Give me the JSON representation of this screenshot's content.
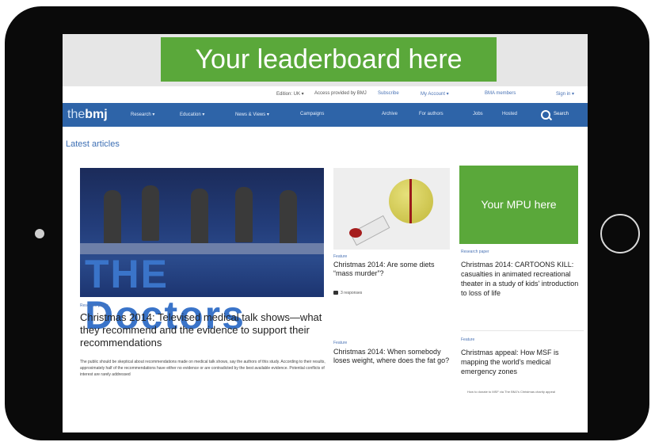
{
  "ads": {
    "leaderboard": "Your leaderboard here",
    "mpu": "Your MPU here"
  },
  "utility": {
    "edition": "Edition: UK ▾",
    "access": "Access provided by BMJ",
    "subscribe": "Subscribe",
    "account": "My Account ▾",
    "members": "BMA members",
    "signin": "Sign in ▾"
  },
  "nav": {
    "logo_the": "the",
    "logo_bmj": "bmj",
    "items": [
      "Research ▾",
      "Education ▾",
      "News & Views ▾",
      "Campaigns"
    ],
    "right_items": [
      "Archive",
      "For authors",
      "Jobs",
      "Hosted"
    ],
    "search": "Search"
  },
  "section_title": "Latest articles",
  "hero": {
    "image_text": "THE Doctors",
    "kicker": "Research paper",
    "headline": "Christmas 2014: Televised medical talk shows—what they recommend and the evidence to support their recommendations",
    "summary": "The public should be skeptical about recommendations made on medical talk shows, say the authors of this study. According to their results, approximately half of the recommendations have either no evidence or are contradicted by the best available evidence. Potential conflicts of interest are rarely addressed"
  },
  "article2": {
    "kicker": "Feature",
    "headline": "Christmas 2014: Are some diets “mass murder”?",
    "responses": "3 responses"
  },
  "article3": {
    "kicker": "Feature",
    "headline": "Christmas 2014: When somebody loses weight, where does the fat go?"
  },
  "article4": {
    "kicker": "Research paper",
    "headline": "Christmas 2014: CARTOONS KILL: casualties in animated recreational theater in a study of kids' introduction to loss of life"
  },
  "article5": {
    "kicker": "Feature",
    "headline": "Christmas appeal: How MSF is mapping the world's medical emergency zones",
    "caption": "How to donate to MSF via The BMJ's Christmas charity appeal"
  }
}
